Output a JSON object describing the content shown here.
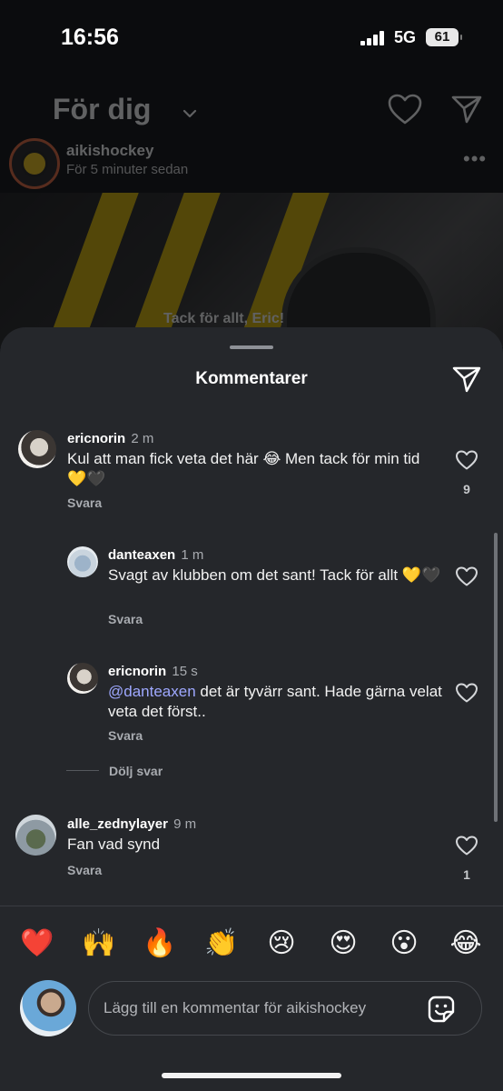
{
  "status_bar": {
    "time": "16:56",
    "network": "5G",
    "battery": "61"
  },
  "feed": {
    "title": "För dig",
    "post": {
      "username": "aikishockey",
      "time_ago": "För 5 minuter sedan",
      "image_caption": "Tack för allt, Eric!"
    }
  },
  "sheet": {
    "title": "Kommentarer"
  },
  "comments": [
    {
      "username": "ericnorin",
      "ago": "2 m",
      "text": "Kul att man fick veta det här 😂 Men tack för min tid 💛🖤",
      "reply_label": "Svara",
      "likes": "9"
    },
    {
      "username": "danteaxen",
      "ago": "1 m",
      "text": "Svagt av klubben om det sant! Tack för allt 💛🖤",
      "reply_label": "Svara"
    },
    {
      "username": "ericnorin",
      "ago": "15 s",
      "mention": "@danteaxen",
      "text": " det är tyvärr sant. Hade gärna velat veta det först..",
      "reply_label": "Svara"
    },
    {
      "username": "alle_zednylayer",
      "ago": "9 m",
      "text": "Fan vad synd",
      "reply_label": "Svara",
      "likes": "1"
    }
  ],
  "hide_replies": "Dölj svar",
  "quick_reactions": [
    "❤️",
    "🙌",
    "🔥",
    "👏",
    "😢",
    "😍",
    "😮",
    "😂"
  ],
  "composer": {
    "placeholder": "Lägg till en kommentar för aikishockey",
    "value": ""
  },
  "colors": {
    "sheet_bg": "#25272b",
    "mention": "#9ea8ff",
    "club_yellow": "#f0c419"
  }
}
